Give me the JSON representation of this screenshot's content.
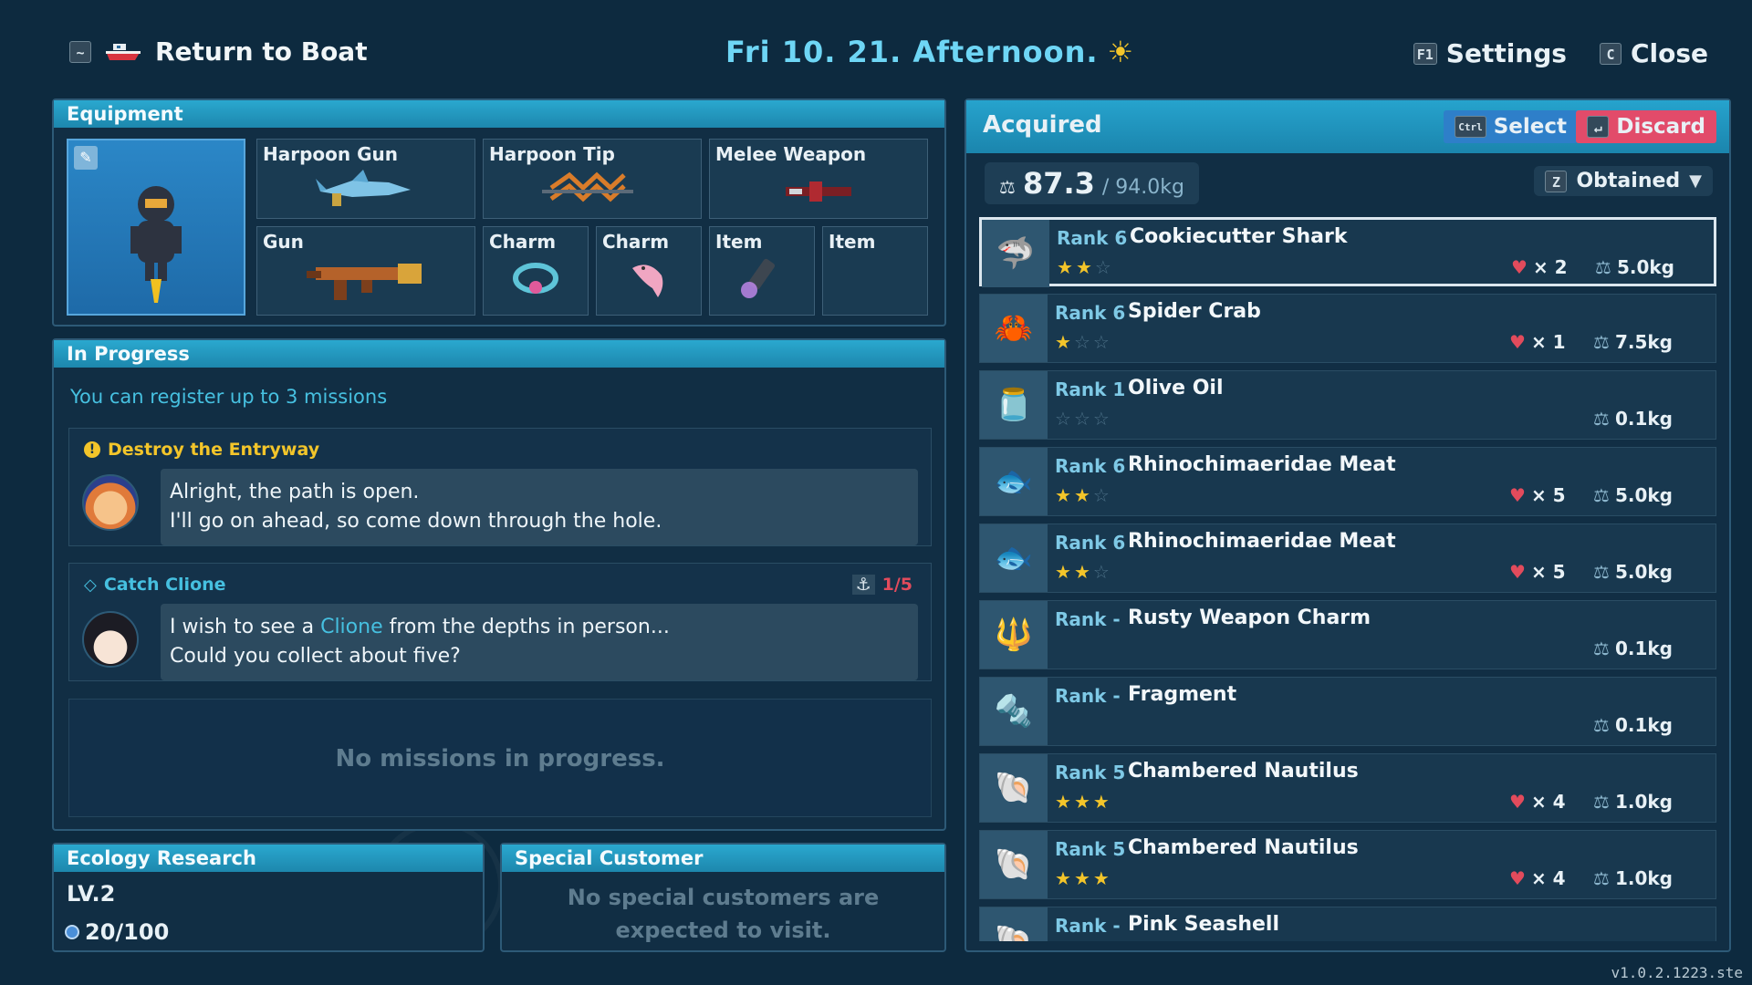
{
  "topbar": {
    "return_key": "~",
    "return_label": "Return to Boat",
    "date": "Fri 10. 21.  Afternoon.",
    "settings_key": "F1",
    "settings_label": "Settings",
    "close_key": "C",
    "close_label": "Close"
  },
  "equipment": {
    "title": "Equipment",
    "slots": [
      {
        "label": "Harpoon Gun",
        "icon": "shark-harpoon-icon"
      },
      {
        "label": "Harpoon Tip",
        "icon": "harpoon-tip-icon"
      },
      {
        "label": "Melee Weapon",
        "icon": "melee-weapon-icon"
      },
      {
        "label": "Gun",
        "icon": "rifle-icon"
      },
      {
        "label": "Charm",
        "icon": "bracelet-charm-icon"
      },
      {
        "label": "Charm",
        "icon": "dolphin-charm-icon"
      },
      {
        "label": "Item",
        "icon": "flashlight-icon"
      },
      {
        "label": "Item",
        "icon": ""
      }
    ]
  },
  "in_progress": {
    "title": "In Progress",
    "register_note": "You can register up to 3 missions",
    "missions": [
      {
        "title": "Destroy the Entryway",
        "line1": "Alright, the path is open.",
        "line2": "I'll go on ahead, so come down through the hole.",
        "title_color": "#f3c52a"
      },
      {
        "title": "Catch Clione",
        "line1_pre": "I wish to see a ",
        "line1_highlight": "Clione",
        "line1_post": " from the depths in person...",
        "line2": "Could you collect about five?",
        "progress": "1/5",
        "title_color": "#46c0e0"
      }
    ],
    "empty_message": "No missions in progress."
  },
  "ecology": {
    "title": "Ecology Research",
    "level": "LV.2",
    "points": "20/100"
  },
  "special_customer": {
    "title": "Special Customer",
    "message_line1": "No special customers are",
    "message_line2": "expected to visit."
  },
  "acquired": {
    "title": "Acquired",
    "select_key": "Ctrl",
    "select_label": "Select",
    "discard_key": "↵",
    "discard_label": "Discard",
    "weight_current": "87.3",
    "weight_max": "/ 94.0kg",
    "sort_key": "Z",
    "sort_label": "Obtained",
    "items": [
      {
        "rank": "Rank 6",
        "name": "Cookiecutter Shark",
        "stars": 2,
        "count": "× 2",
        "weight": "5.0kg",
        "icon": "shark-thumb-icon"
      },
      {
        "rank": "Rank 6",
        "name": "Spider Crab",
        "stars": 1,
        "count": "× 1",
        "weight": "7.5kg",
        "icon": "crab-thumb-icon"
      },
      {
        "rank": "Rank 1",
        "name": "Olive Oil",
        "stars": 0,
        "count": "",
        "weight": "0.1kg",
        "icon": "bottle-thumb-icon"
      },
      {
        "rank": "Rank 6",
        "name": "Rhinochimaeridae Meat",
        "stars": 2,
        "count": "× 5",
        "weight": "5.0kg",
        "icon": "fish-thumb-icon"
      },
      {
        "rank": "Rank 6",
        "name": "Rhinochimaeridae Meat",
        "stars": 2,
        "count": "× 5",
        "weight": "5.0kg",
        "icon": "fish-thumb-icon"
      },
      {
        "rank": "Rank -",
        "name": "Rusty Weapon Charm",
        "stars": null,
        "count": "",
        "weight": "0.1kg",
        "icon": "charm-thumb-icon"
      },
      {
        "rank": "Rank -",
        "name": "Fragment",
        "stars": null,
        "count": "",
        "weight": "0.1kg",
        "icon": "bolt-thumb-icon"
      },
      {
        "rank": "Rank 5",
        "name": "Chambered Nautilus",
        "stars": 3,
        "count": "× 4",
        "weight": "1.0kg",
        "icon": "nautilus-thumb-icon"
      },
      {
        "rank": "Rank 5",
        "name": "Chambered Nautilus",
        "stars": 3,
        "count": "× 4",
        "weight": "1.0kg",
        "icon": "nautilus-thumb-icon"
      },
      {
        "rank": "Rank -",
        "name": "Pink Seashell",
        "stars": null,
        "count": "",
        "weight": "",
        "icon": "seashell-thumb-icon"
      }
    ]
  },
  "version": "v1.0.2.1223.ste"
}
